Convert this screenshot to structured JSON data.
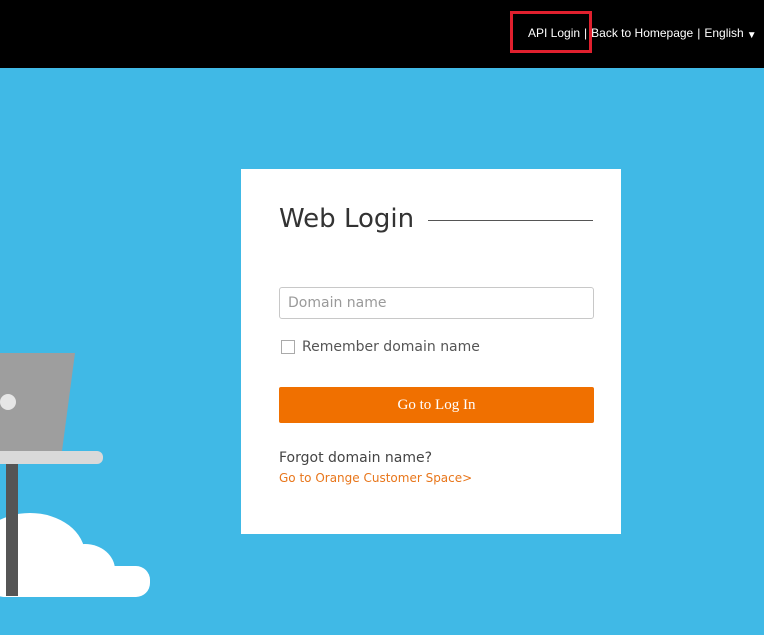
{
  "header": {
    "nav": [
      {
        "label": "API Login"
      },
      {
        "label": "Back to Homepage"
      },
      {
        "label": "English"
      }
    ],
    "separator": "|",
    "language_caret_icon": "caret-down-icon"
  },
  "login": {
    "title": "Web Login",
    "domain_placeholder": "Domain name",
    "domain_value": "",
    "remember_label": "Remember domain name",
    "remember_checked": false,
    "submit_label": "Go to Log In",
    "forgot_text": "Forgot domain name?",
    "customer_link": "Go to Orange Customer Space>"
  },
  "colors": {
    "background": "#40b9e6",
    "topbar": "#000000",
    "accent": "#f07000",
    "link": "#e8761b",
    "highlight": "#e0202e"
  },
  "illustration": {
    "icons": [
      "laptop-icon",
      "desk-icon",
      "cloud-icon"
    ]
  }
}
